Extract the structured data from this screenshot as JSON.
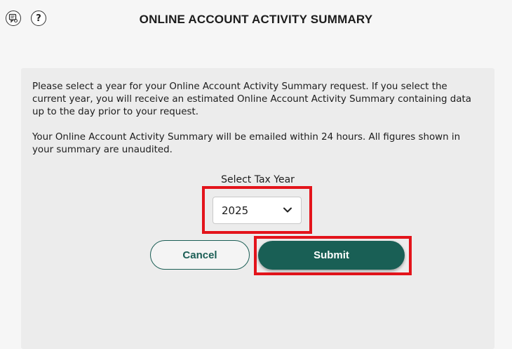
{
  "header": {
    "title": "ONLINE ACCOUNT ACTIVITY SUMMARY",
    "icons": [
      "chat-icon",
      "help-icon"
    ],
    "help_glyph": "?"
  },
  "form": {
    "intro_paragraph_1": "Please select a year for your Online Account Activity Summary request. If you select the current year, you will receive an estimated Online Account Activity Summary containing data up to the day prior to your request.",
    "intro_paragraph_2": "Your Online Account Activity Summary will be emailed within 24 hours. All figures shown in your summary are unaudited.",
    "year_label": "Select Tax Year",
    "year_value": "2025",
    "cancel_label": "Cancel",
    "submit_label": "Submit"
  },
  "colors": {
    "accent": "#195f55",
    "highlight": "#e3141b",
    "panel_bg": "#ececec"
  }
}
